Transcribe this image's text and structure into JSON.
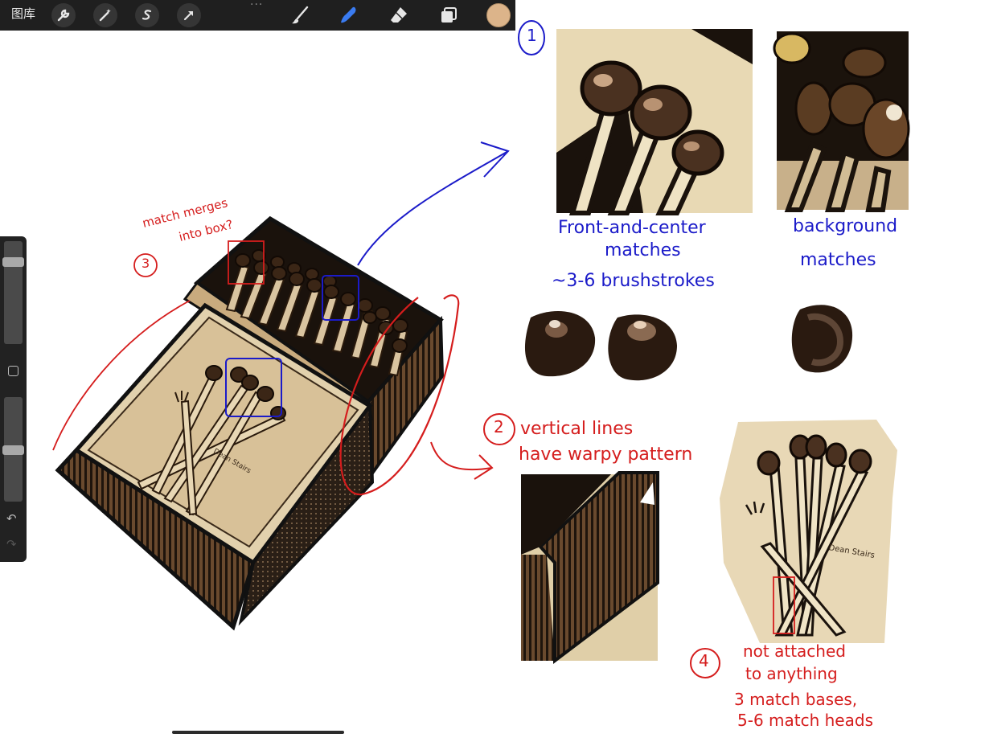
{
  "toolbar": {
    "gallery_label": "图库",
    "tools": [
      "wrench-icon",
      "magic-wand-icon",
      "selection-icon",
      "transform-arrow-icon",
      "brush-icon",
      "smudge-icon",
      "eraser-icon",
      "layers-icon"
    ],
    "more_label": "···",
    "current_color": "#dcb48a",
    "active_tool_color": "#3a7bf0"
  },
  "sidebar": {
    "undo_icon": "↶",
    "redo_icon": "↷"
  },
  "annotations": {
    "match_merges": "match merges",
    "into_box": "into box?",
    "num3": "3",
    "num1": "1",
    "front_center_1": "Front-and-center",
    "front_center_2": "matches",
    "brushstrokes": "~3-6 brushstrokes",
    "background_1": "background",
    "background_2": "matches",
    "num2": "2",
    "vertical_lines_1": "vertical lines",
    "vertical_lines_2": "have warpy pattern",
    "num4": "4",
    "not_attached_1": "not attached",
    "not_attached_2": "to anything",
    "match_bases": "3 match bases,",
    "match_heads": "5-6 match heads"
  },
  "artwork": {
    "box_signature": "Dean Stairs",
    "closeup_signature": "Dean Stairs",
    "ink_red": "#d51d1d",
    "ink_blue": "#1b1bc9"
  }
}
